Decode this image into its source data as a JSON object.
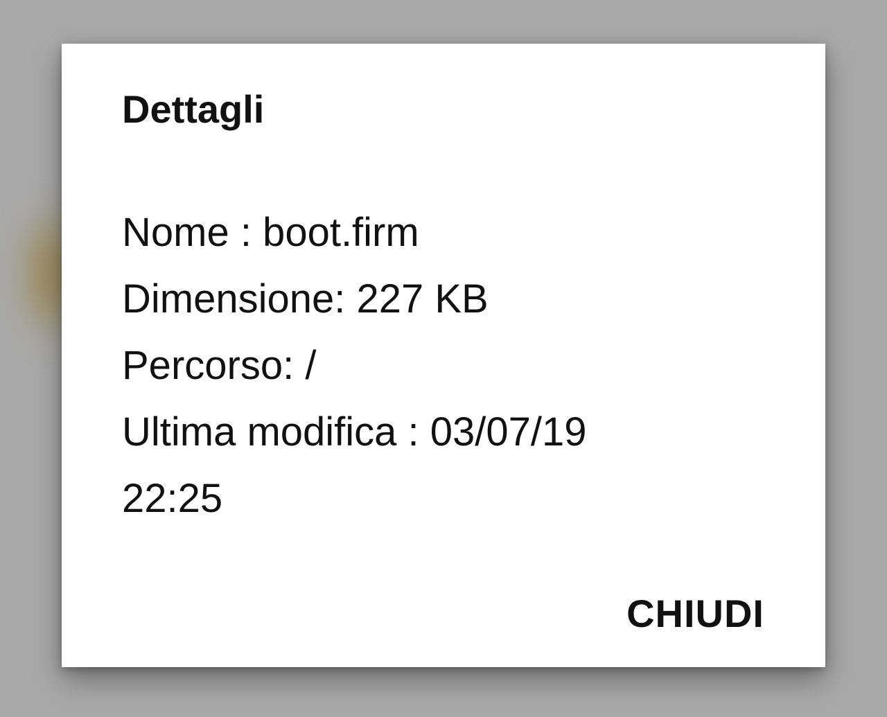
{
  "dialog": {
    "title": "Dettagli",
    "details": {
      "name": "Nome : boot.firm",
      "size": "Dimensione: 227 KB",
      "path": "Percorso: /",
      "modified_line1": "Ultima modifica : 03/07/19",
      "modified_line2": "22:25"
    },
    "close_label": "CHIUDI"
  },
  "colors": {
    "scrim": "#a9a9a9",
    "dialog_background": "#ffffff",
    "text": "#111111"
  }
}
